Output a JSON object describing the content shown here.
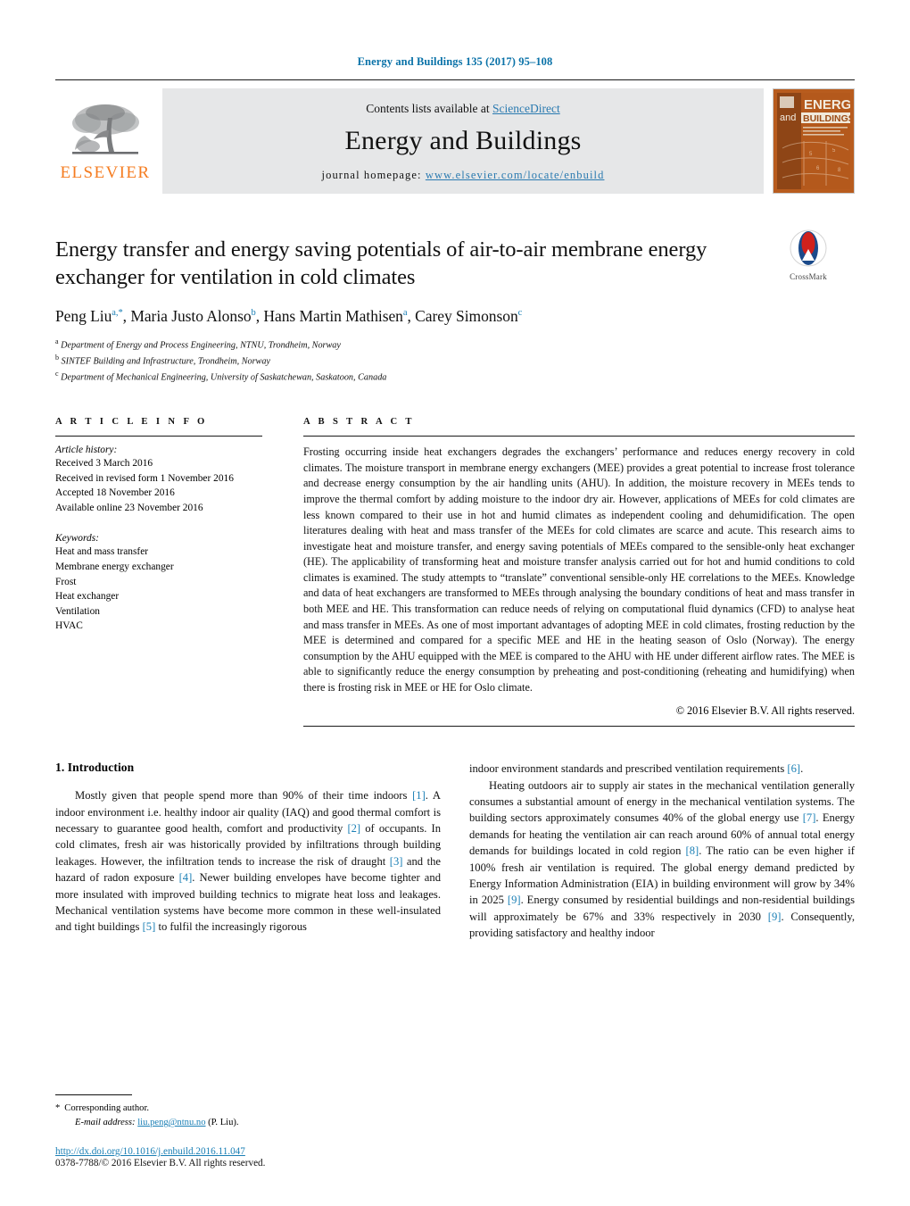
{
  "running_head": "Energy and Buildings 135 (2017) 95–108",
  "masthead": {
    "publisher_name": "ELSEVIER",
    "contents_prefix": "Contents lists available at ",
    "contents_link": "ScienceDirect",
    "journal_title": "Energy and Buildings",
    "homepage_label": "journal homepage:",
    "homepage_url": "www.elsevier.com/locate/enbuild",
    "cover_title_top": "ENERGY",
    "cover_title_and": "and",
    "cover_title_bottom": "BUILDINGS"
  },
  "article": {
    "title": "Energy transfer and energy saving potentials of air-to-air membrane energy exchanger for ventilation in cold climates",
    "crossmark_label": "CrossMark",
    "authors": [
      {
        "name": "Peng Liu",
        "sup": "a,*"
      },
      {
        "name": "Maria Justo Alonso",
        "sup": "b"
      },
      {
        "name": "Hans Martin Mathisen",
        "sup": "a"
      },
      {
        "name": "Carey Simonson",
        "sup": "c"
      }
    ],
    "affiliations": [
      {
        "marker": "a",
        "text": "Department of Energy and Process Engineering, NTNU, Trondheim, Norway"
      },
      {
        "marker": "b",
        "text": "SINTEF Building and Infrastructure, Trondheim, Norway"
      },
      {
        "marker": "c",
        "text": "Department of Mechanical Engineering, University of Saskatchewan, Saskatoon, Canada"
      }
    ]
  },
  "article_info": {
    "label": "A R T I C L E    I N F O",
    "history_heading": "Article history:",
    "history": [
      "Received 3 March 2016",
      "Received in revised form 1 November 2016",
      "Accepted 18 November 2016",
      "Available online 23 November 2016"
    ],
    "keywords_heading": "Keywords:",
    "keywords": [
      "Heat and mass transfer",
      "Membrane energy exchanger",
      "Frost",
      "Heat exchanger",
      "Ventilation",
      "HVAC"
    ]
  },
  "abstract": {
    "label": "A B S T R A C T",
    "text": "Frosting occurring inside heat exchangers degrades the exchangers’ performance and reduces energy recovery in cold climates. The moisture transport in membrane energy exchangers (MEE) provides a great potential to increase frost tolerance and decrease energy consumption by the air handling units (AHU). In addition, the moisture recovery in MEEs tends to improve the thermal comfort by adding moisture to the indoor dry air. However, applications of MEEs for cold climates are less known compared to their use in hot and humid climates as independent cooling and dehumidification. The open literatures dealing with heat and mass transfer of the MEEs for cold climates are scarce and acute. This research aims to investigate heat and moisture transfer, and energy saving potentials of MEEs compared to the sensible-only heat exchanger (HE). The applicability of transforming heat and moisture transfer analysis carried out for hot and humid conditions to cold climates is examined. The study attempts to “translate” conventional sensible-only HE correlations to the MEEs. Knowledge and data of heat exchangers are transformed to MEEs through analysing the boundary conditions of heat and mass transfer in both MEE and HE. This transformation can reduce needs of relying on computational fluid dynamics (CFD) to analyse heat and mass transfer in MEEs. As one of most important advantages of adopting MEE in cold climates, frosting reduction by the MEE is determined and compared for a specific MEE and HE in the heating season of Oslo (Norway). The energy consumption by the AHU equipped with the MEE is compared to the AHU with HE under different airflow rates. The MEE is able to significantly reduce the energy consumption by preheating and post-conditioning (reheating and humidifying) when there is frosting risk in MEE or HE for Oslo climate.",
    "copyright": "© 2016 Elsevier B.V. All rights reserved."
  },
  "body": {
    "section_heading": "1.  Introduction",
    "left_paragraph_1": [
      {
        "t": "Mostly given that people spend more than 90% of their time indoors "
      },
      {
        "t": "[1]",
        "ref": true
      },
      {
        "t": ". A indoor environment i.e. healthy indoor air quality (IAQ) and good thermal comfort is necessary to guarantee good health, comfort and productivity "
      },
      {
        "t": "[2]",
        "ref": true
      },
      {
        "t": " of occupants. In cold climates, fresh air was historically provided by infiltrations through building leakages. However, the infiltration tends to increase the risk of draught "
      },
      {
        "t": "[3]",
        "ref": true
      },
      {
        "t": " and the hazard of radon exposure "
      },
      {
        "t": "[4]",
        "ref": true
      },
      {
        "t": ". Newer building envelopes have become tighter and more insulated with improved building technics to migrate heat loss and leakages. Mechanical ventilation systems have become more common in these well-insulated and tight buildings "
      },
      {
        "t": "[5]",
        "ref": true
      },
      {
        "t": " to fulfil the increasingly rigorous"
      }
    ],
    "right_paragraph_1": [
      {
        "t": "indoor environment standards and prescribed ventilation requirements "
      },
      {
        "t": "[6]",
        "ref": true
      },
      {
        "t": "."
      }
    ],
    "right_paragraph_2": [
      {
        "t": "Heating outdoors air to supply air states in the mechanical ventilation generally consumes a substantial amount of energy in the mechanical ventilation systems. The building sectors approximately consumes 40% of the global energy use "
      },
      {
        "t": "[7]",
        "ref": true
      },
      {
        "t": ". Energy demands for heating the ventilation air can reach around 60% of annual total energy demands for buildings located in cold region "
      },
      {
        "t": "[8]",
        "ref": true
      },
      {
        "t": ". The ratio can be even higher if 100% fresh air ventilation is required. The global energy demand predicted by Energy Information Administration (EIA) in building environment will grow by 34% in 2025 "
      },
      {
        "t": "[9]",
        "ref": true
      },
      {
        "t": ". Energy consumed by residential buildings and non-residential buildings will approximately be 67% and 33% respectively in 2030 "
      },
      {
        "t": "[9]",
        "ref": true
      },
      {
        "t": ". Consequently, providing satisfactory and healthy indoor"
      }
    ]
  },
  "footnote": {
    "corresponding_marker": "*",
    "corresponding_text": "Corresponding author.",
    "email_label": "E-mail address:",
    "email": "liu.peng@ntnu.no",
    "email_suffix": "(P. Liu).",
    "doi": "http://dx.doi.org/10.1016/j.enbuild.2016.11.047",
    "issn_line": "0378-7788/© 2016 Elsevier B.V. All rights reserved."
  },
  "colors": {
    "link_blue": "#1a7fb5",
    "header_blue": "#0a72a8",
    "elsevier_orange": "#f57c20",
    "band_gray": "#e6e7e8",
    "cover_orange": "#b85c1e"
  }
}
